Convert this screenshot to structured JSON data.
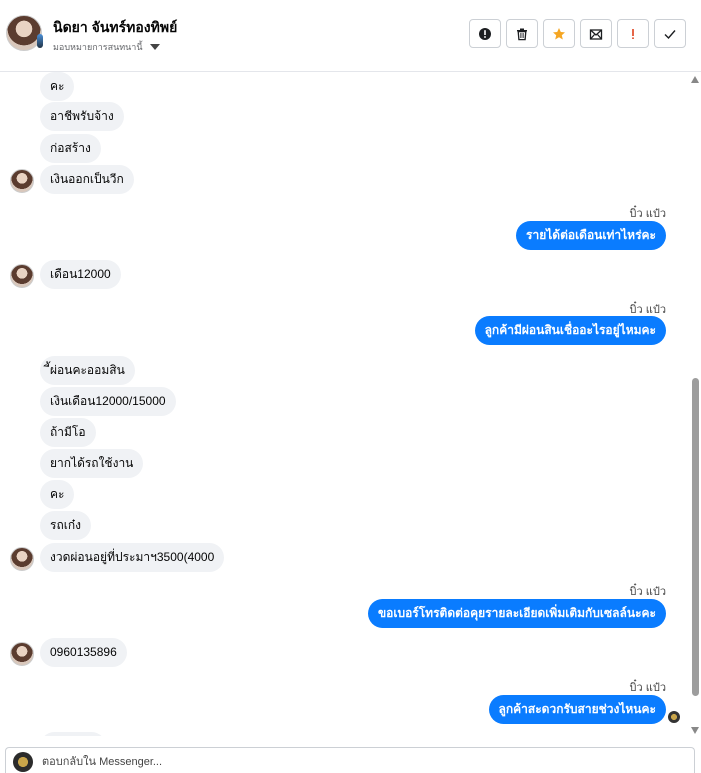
{
  "header": {
    "contact_name": "นิดยา จันทร์ทองทิพย์",
    "assign_label": "มอบหมายการสนทนานี้"
  },
  "toolbar": {
    "buttons": [
      {
        "name": "report-spam",
        "icon": "exclamation-circle-icon"
      },
      {
        "name": "delete",
        "icon": "trash-icon"
      },
      {
        "name": "star",
        "icon": "star-icon",
        "color": "#f5a623"
      },
      {
        "name": "mark-unread",
        "icon": "envelope-icon"
      },
      {
        "name": "mark-follow-up",
        "icon": "exclamation-icon",
        "color": "#e0401b"
      },
      {
        "name": "mark-done",
        "icon": "check-icon"
      }
    ]
  },
  "colors": {
    "outgoing_bubble": "#0a7cff",
    "incoming_bubble": "#f0f2f5"
  },
  "messages": {
    "m1": "คะ",
    "m2": "อาชีพรับจ้าง",
    "m3": "ก่อสร้าง",
    "m4": "เงินออกเป็นวีก",
    "s1": "บิ๋ว แป๋ว",
    "o1": "รายได้ต่อเดือนเท่าไหร่คะ",
    "m5": "เดือน12000",
    "s2": "บิ๋ว แป๋ว",
    "o2": "ลูกค้ามีผ่อนสินเชื่ออะไรอยู่ไหมคะ",
    "m6": "ี้ผ่อนคะออมสิน",
    "m7": "เงินเดือน12000/15000",
    "m8": "ถ้ามีโอ",
    "m9": "ยากได้รถใช้งาน",
    "m10": "คะ",
    "m11": "รถเก๋ง",
    "m12": "งวดผ่อนอยู่ที่ประมาฯ3500(4000",
    "s3": "บิ๋ว แป๋ว",
    "o3": "ขอเบอร์โทรติดต่อคุยรายละเอียดเพิ่มเติมกับเซลล์นะคะ",
    "m13": "0960135896",
    "s4": "บิ๋ว แป๋ว",
    "o4": "ลูกค้าสะดวกรับสายช่วงไหนคะ"
  },
  "composer": {
    "placeholder": "ตอบกลับใน Messenger..."
  }
}
